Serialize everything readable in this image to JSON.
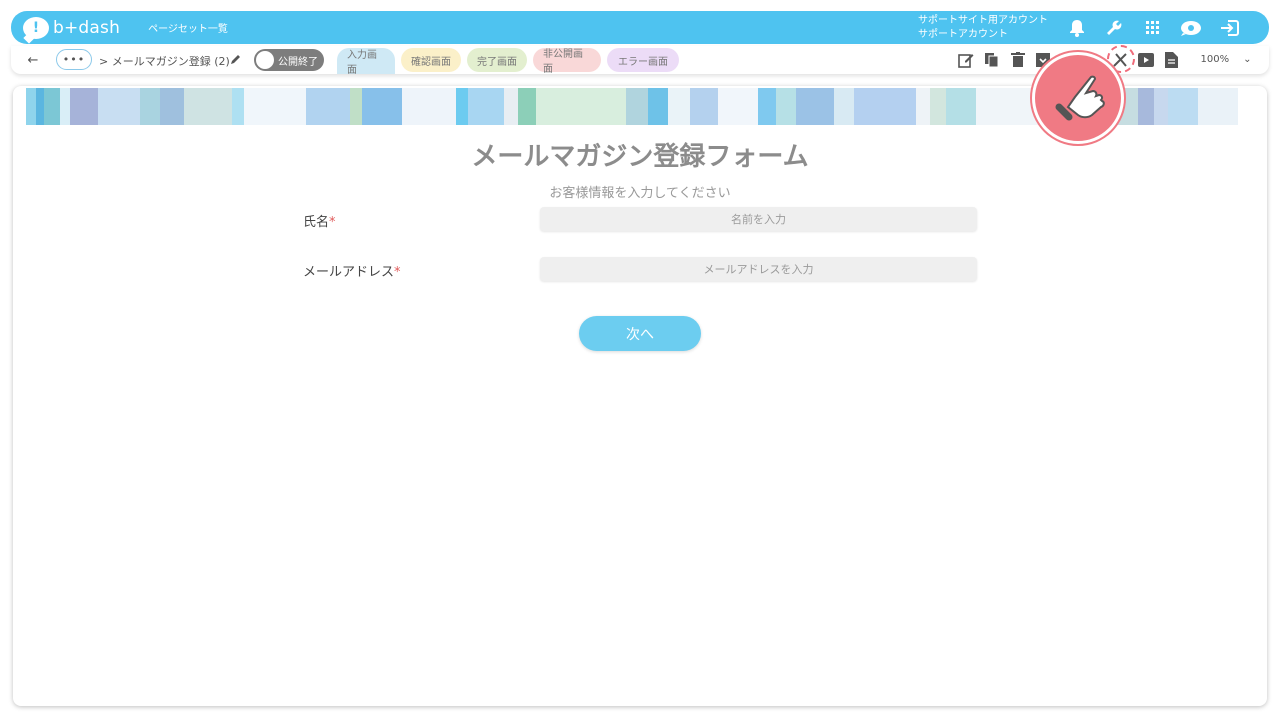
{
  "header": {
    "logo_text": "b+dash",
    "pageset_link": "ページセット一覧",
    "account_line1": "サポートサイト用アカウント",
    "account_line2": "サポートアカウント",
    "icons": [
      "bell-icon",
      "wrench-icon",
      "grid-icon",
      "notification-cloud-icon",
      "logout-icon"
    ]
  },
  "toolbar": {
    "more_label": "•••",
    "breadcrumb": "> メールマガジン登録 (2)",
    "toggle_label": "公開終了",
    "tabs": [
      {
        "label": "入力画面",
        "active": true
      },
      {
        "label": "確認画面"
      },
      {
        "label": "完了画面"
      },
      {
        "label": "非公開画面"
      },
      {
        "label": "エラー画面"
      }
    ],
    "zoom": "100%",
    "tools": [
      "edit-icon",
      "copy-icon",
      "trash-icon",
      "archive-icon",
      "tools-icon",
      "preview-icon",
      "document-icon"
    ]
  },
  "form": {
    "title": "メールマガジン登録フォーム",
    "subtitle": "お客様情報を入力してください",
    "fields": [
      {
        "label": "氏名",
        "required_mark": "*",
        "placeholder": "名前を入力"
      },
      {
        "label": "メールアドレス",
        "required_mark": "*",
        "placeholder": "メールアドレスを入力"
      }
    ],
    "next_button": "次へ"
  },
  "colors": {
    "header_bg": "#4ec3f0",
    "button_bg": "#6ccdf0",
    "highlight": "#f07a84"
  }
}
